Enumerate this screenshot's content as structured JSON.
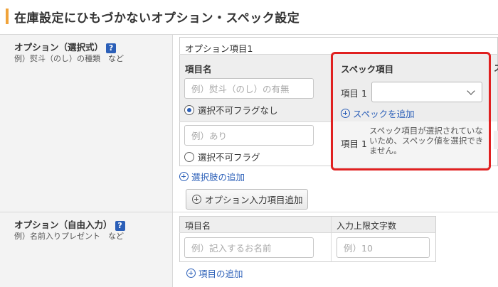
{
  "page": {
    "title": "在庫設定にひもづかないオプション・スペック設定"
  },
  "option_select": {
    "title": "オプション（選択式）",
    "help": "?",
    "sub": "例）熨斗（のし）の種類　など",
    "option_item_name": "オプション項目1",
    "col_item_name": "項目名",
    "col_spec_item": "スペック項目",
    "choices": [
      {
        "placeholder": "例）熨斗（のし）の有無",
        "radio_label": "選択不可フラグなし",
        "checked": true
      },
      {
        "placeholder": "例）あり",
        "radio_label": "選択不可フラグ",
        "checked": false
      }
    ],
    "spec_label_1": "項目 1",
    "add_spec": "スペックを追加",
    "spec_label_2": "項目 1",
    "spec_notice": "スペック項目が選択されていないため、スペック値を選択できません。",
    "add_choice": "選択肢の追加",
    "add_option_input": "オプション入力項目追加"
  },
  "option_free": {
    "title": "オプション（自由入力）",
    "help": "?",
    "sub": "例）名前入りプレゼント　など",
    "col_item_name": "項目名",
    "col_max_chars": "入力上限文字数",
    "item_placeholder": "例）記入するお名前",
    "max_placeholder": "例）10",
    "add_item": "項目の追加"
  },
  "colors": {
    "accent": "#f0a33a",
    "link": "#2b5fb8",
    "highlight": "#e02020"
  }
}
